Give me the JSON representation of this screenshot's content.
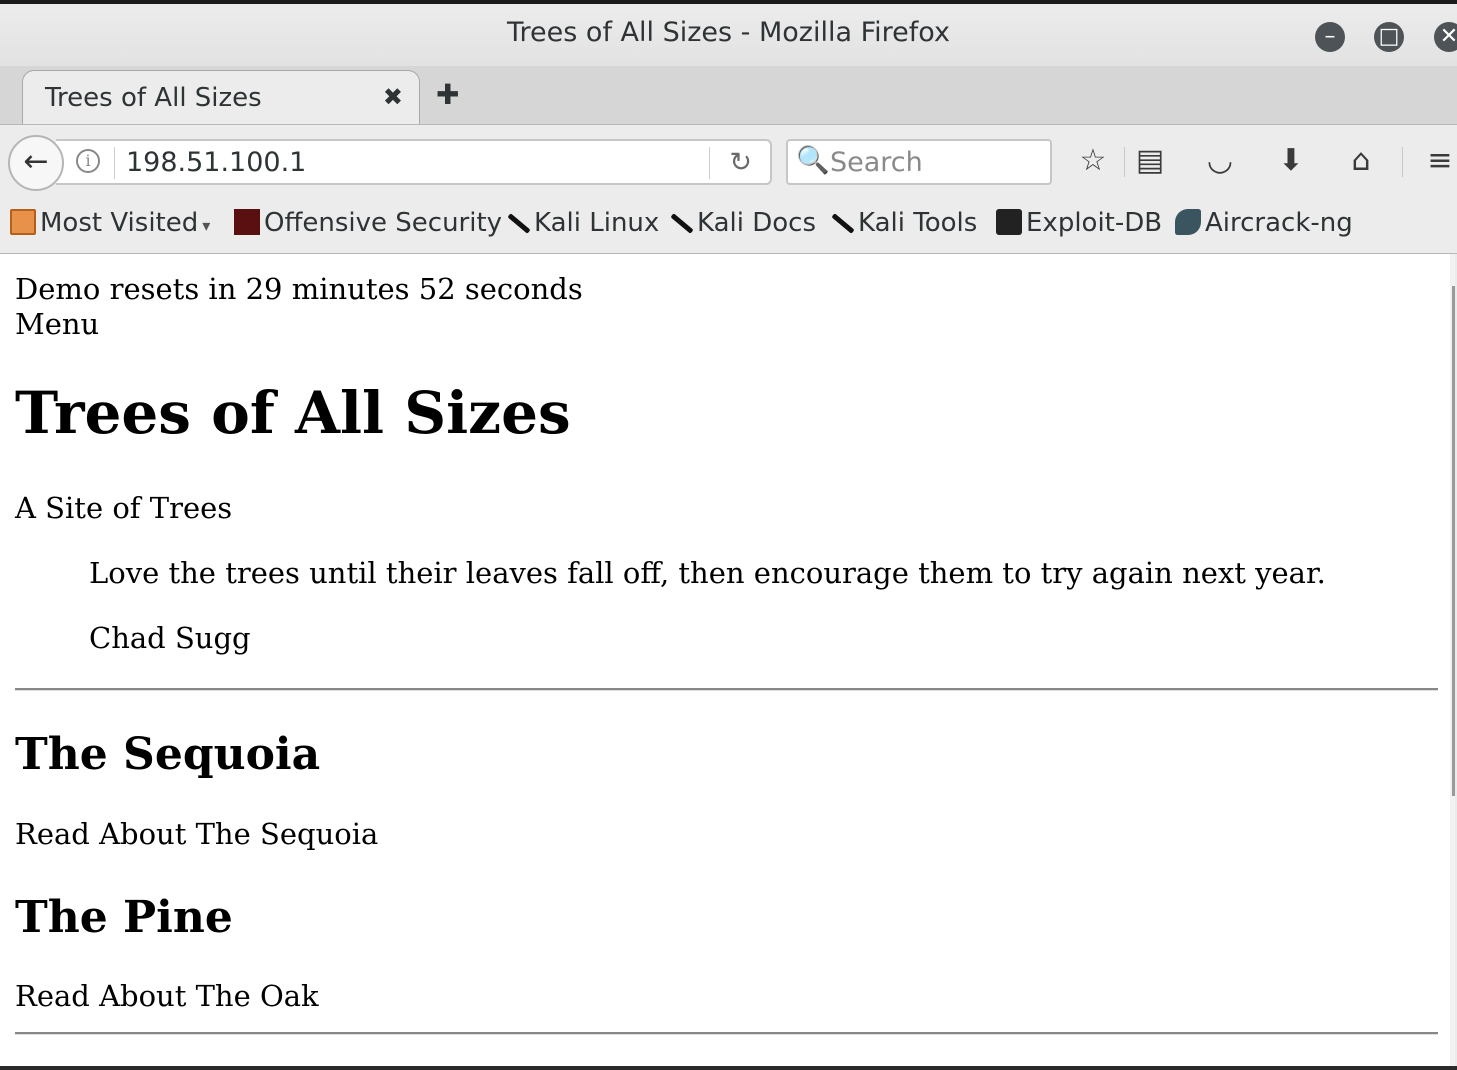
{
  "window": {
    "title": "Trees of All Sizes - Mozilla Firefox",
    "controls": {
      "minimize": "–",
      "maximize": "□",
      "close": "✕"
    }
  },
  "tabs": [
    {
      "label": "Trees of All Sizes",
      "close": "✖"
    }
  ],
  "new_tab": "✚",
  "navbar": {
    "back": "←",
    "url": "198.51.100.1",
    "reload": "↻",
    "search_placeholder": "Search",
    "search_icon": "🔍",
    "icons": {
      "bookmark_star": "☆",
      "reading_list": "▤",
      "pocket": "◡",
      "download": "⬇",
      "home": "⌂",
      "menu": "≡"
    }
  },
  "bookmarks": [
    {
      "label": "Most Visited",
      "icon": "folder-icon"
    },
    {
      "label": "Offensive Security",
      "icon": "offsec-icon"
    },
    {
      "label": "Kali Linux",
      "icon": "kali-icon"
    },
    {
      "label": "Kali Docs",
      "icon": "kali-icon"
    },
    {
      "label": "Kali Tools",
      "icon": "kali-icon"
    },
    {
      "label": "Exploit-DB",
      "icon": "exploit-db-icon"
    },
    {
      "label": "Aircrack-ng",
      "icon": "aircrack-icon"
    }
  ],
  "bookmarks_caret": "▾",
  "page": {
    "demo_reset": "Demo resets in 29 minutes 52 seconds",
    "menu": "Menu",
    "title": "Trees of All Sizes",
    "tagline": "A Site of Trees",
    "quote": "Love the trees until their leaves fall off, then encourage them to try again next year.",
    "quote_author": "Chad Sugg",
    "sections": [
      {
        "heading": "The Sequoia",
        "link": "Read About The Sequoia"
      },
      {
        "heading": "The Pine",
        "link": "Read About The Oak"
      }
    ]
  }
}
